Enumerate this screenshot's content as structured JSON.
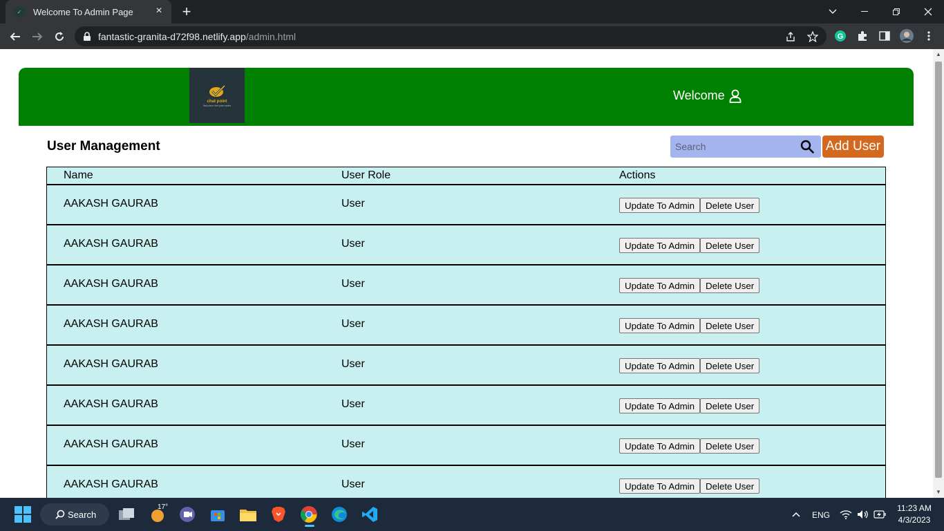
{
  "browser": {
    "tab_title": "Welcome To Admin Page",
    "url_domain": "fantastic-granita-d72f98.netlify.app",
    "url_path": "/admin.html"
  },
  "header": {
    "logo_title": "chat point",
    "logo_tagline": "that place that point wales",
    "welcome_label": "Welcome",
    "bg_color": "#008000"
  },
  "main": {
    "title": "User Management",
    "search_placeholder": "Search",
    "add_user_label": "Add User",
    "add_user_color": "#d2691e"
  },
  "table": {
    "columns": [
      "Name",
      "User Role",
      "Actions"
    ],
    "rows": [
      {
        "name": "AAKASH GAURAB",
        "role": "User",
        "update_label": "Update To Admin",
        "delete_label": "Delete User"
      },
      {
        "name": "AAKASH GAURAB",
        "role": "User",
        "update_label": "Update To Admin",
        "delete_label": "Delete User"
      },
      {
        "name": "AAKASH GAURAB",
        "role": "User",
        "update_label": "Update To Admin",
        "delete_label": "Delete User"
      },
      {
        "name": "AAKASH GAURAB",
        "role": "User",
        "update_label": "Update To Admin",
        "delete_label": "Delete User"
      },
      {
        "name": "AAKASH GAURAB",
        "role": "User",
        "update_label": "Update To Admin",
        "delete_label": "Delete User"
      },
      {
        "name": "AAKASH GAURAB",
        "role": "User",
        "update_label": "Update To Admin",
        "delete_label": "Delete User"
      },
      {
        "name": "AAKASH GAURAB",
        "role": "User",
        "update_label": "Update To Admin",
        "delete_label": "Delete User"
      },
      {
        "name": "AAKASH GAURAB",
        "role": "User",
        "update_label": "Update To Admin",
        "delete_label": "Delete User"
      }
    ],
    "row_color": "#c9f0f0"
  },
  "taskbar": {
    "search_label": "Search",
    "weather_temp": "17°",
    "language": "ENG",
    "time": "11:23 AM",
    "date": "4/3/2023"
  }
}
